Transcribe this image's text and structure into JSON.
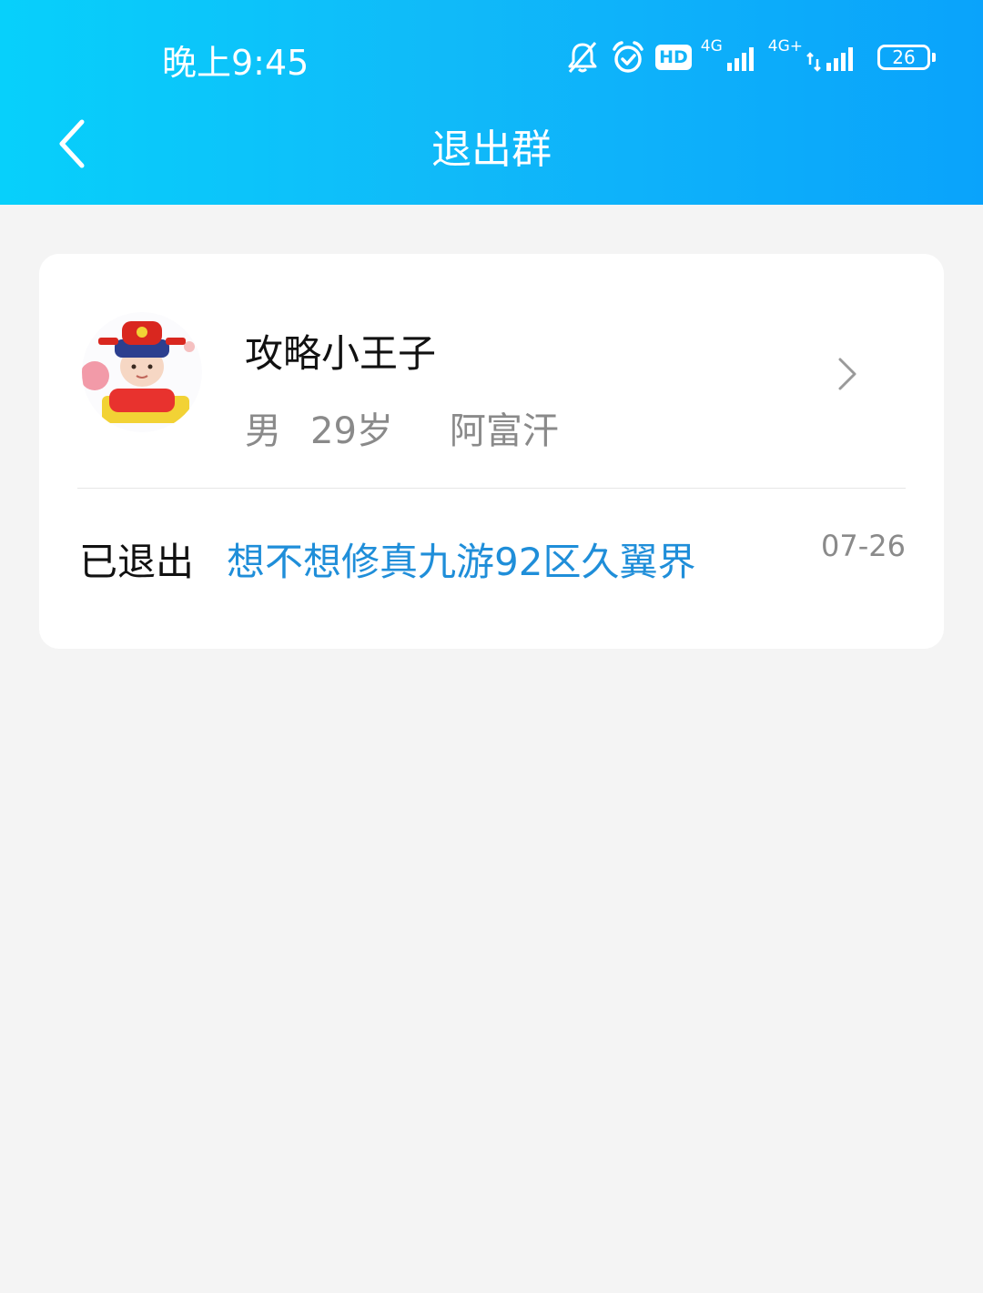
{
  "status_bar": {
    "time": "晚上9:45",
    "hd_label": "HD",
    "sim1_label": "4G",
    "sim2_label": "4G+",
    "battery_level": "26"
  },
  "header": {
    "title": "退出群"
  },
  "user": {
    "name": "攻略小王子",
    "gender": "男",
    "age": "29岁",
    "location": "阿富汗"
  },
  "record": {
    "status": "已退出",
    "group_name": "想不想修真九游92区久翼界",
    "date": "07-26"
  },
  "colors": {
    "header_gradient_start": "#07d0fb",
    "header_gradient_end": "#0aa3fb",
    "link_blue": "#1f8ed9",
    "background": "#f4f4f4"
  }
}
